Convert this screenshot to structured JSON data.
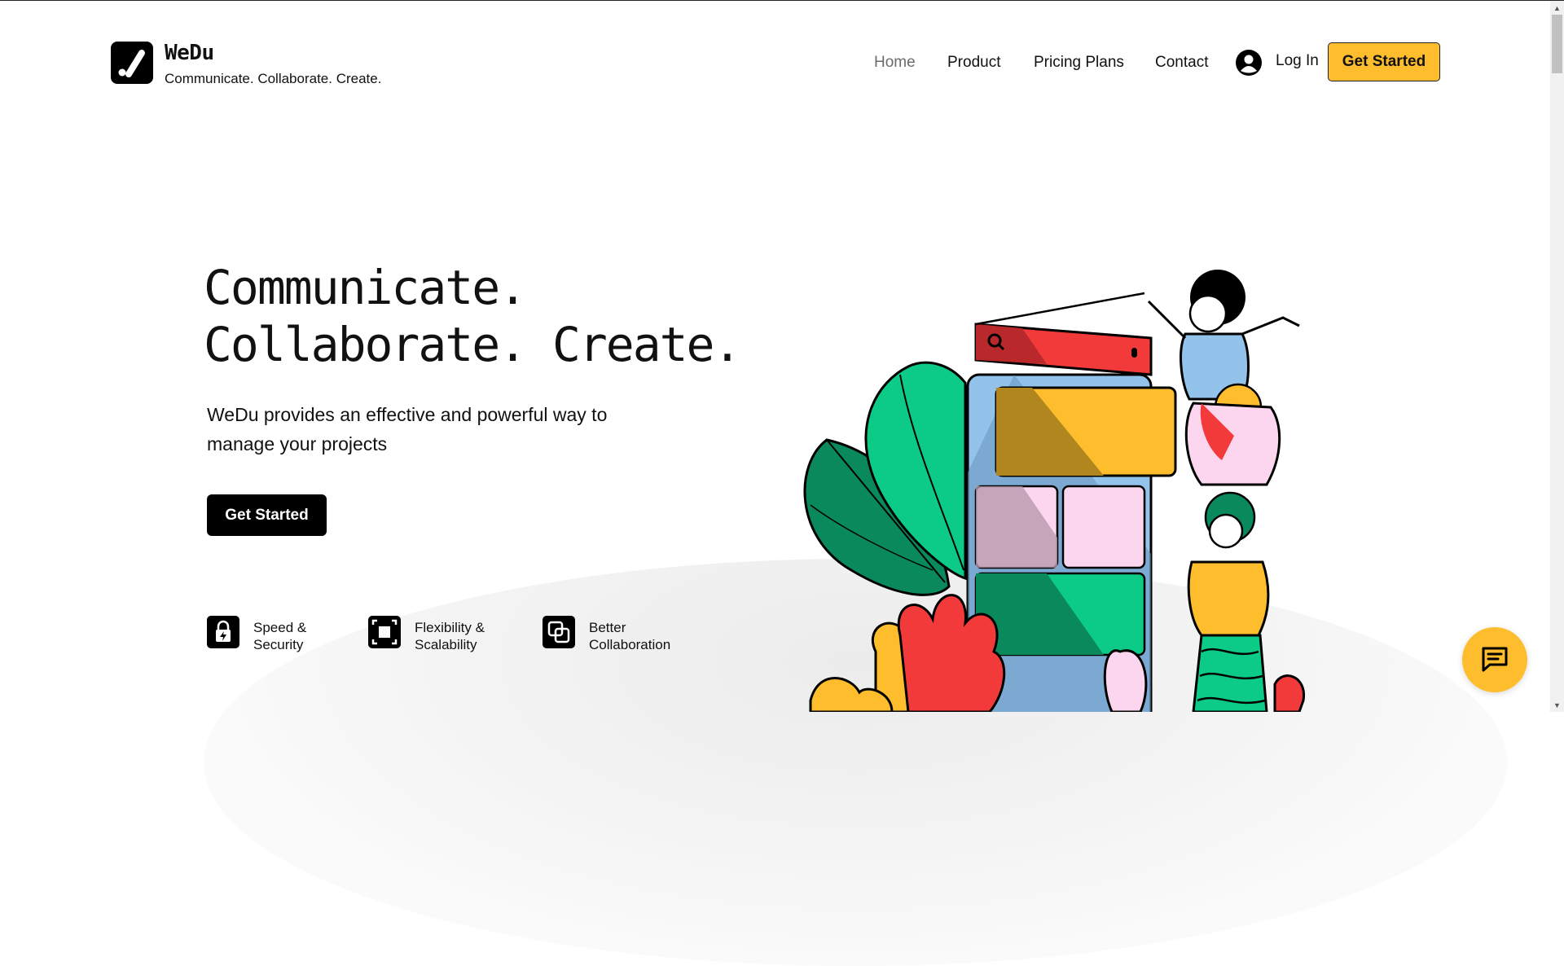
{
  "brand": {
    "name": "WeDu",
    "tagline": "Communicate. Collaborate. Create.",
    "logo_icon": "checkmark-slash-icon"
  },
  "nav": {
    "items": [
      {
        "label": "Home",
        "active": true
      },
      {
        "label": "Product"
      },
      {
        "label": "Pricing Plans"
      },
      {
        "label": "Contact"
      }
    ],
    "login_label": "Log In",
    "cta_label": "Get Started",
    "avatar_icon": "user-circle-icon"
  },
  "hero": {
    "title_line1": "Communicate.",
    "title_line2": "Collaborate. Create.",
    "description": "WeDu provides an effective and powerful way to manage your projects",
    "cta_label": "Get Started"
  },
  "features": [
    {
      "icon": "lock-bolt-icon",
      "line1": "Speed &",
      "line2": "Security"
    },
    {
      "icon": "expand-square-icon",
      "line1": "Flexibility &",
      "line2": "Scalability"
    },
    {
      "icon": "overlap-squares-icon",
      "line1": "Better",
      "line2": "Collaboration"
    }
  ],
  "chat": {
    "icon": "chat-bubble-icon"
  },
  "colors": {
    "accent": "#fdbd2c",
    "black": "#000000",
    "nav_active": "#6b6b6b",
    "phone_blue": "#93c3ea",
    "leaf_green": "#0ba26e",
    "leaf_bright": "#0bcb87",
    "banner_red": "#f23a3a",
    "card_pink": "#fcd6ef"
  }
}
